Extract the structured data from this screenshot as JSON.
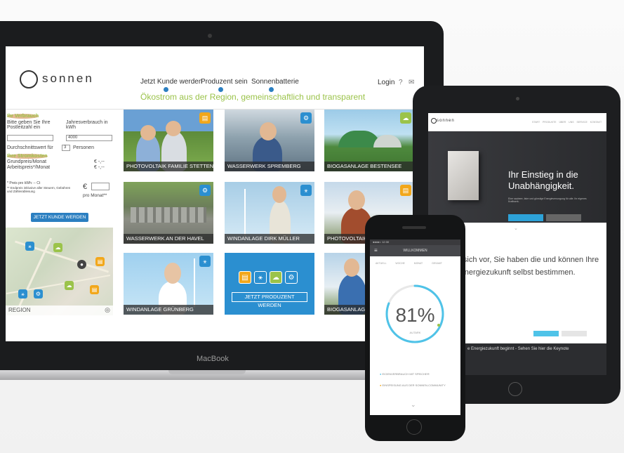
{
  "laptop": {
    "brand_label": "MacBook",
    "logo_text": "sonnen",
    "nav": {
      "item1": "Jetzt Kunde werden",
      "item2": "Produzent sein",
      "item3": "Sonnenbatterie"
    },
    "tagline": "Ökostrom aus der Region, gemeinschaftlich und transparent",
    "login": "Login",
    "calculator": {
      "heading_usage": "Ihr Verbrauch",
      "postcode_label": "Bitte geben Sie Ihre Postleitzahl ein",
      "annual_label": "Jahresverbrauch in kWh",
      "annual_value": "4000",
      "avg_label": "Durchschnittswert für",
      "persons_value": "3",
      "persons_label": "Personen",
      "heading_costs": "Ihre Stromkosten",
      "base_price_label": "Grundpreis/Monat",
      "base_price_value": "€ -,--",
      "work_price_label": "Arbeitspreis*/Monat",
      "work_price_value": "€ -,--",
      "note1": "* Preis pro kWh: -- Ct",
      "note2": "** Endpreis inklusive aller Steuern, Gebühren und Zählerablesung",
      "euro_sign": "€",
      "per_month": "pro Monat**",
      "cta": "JETZT KUNDE WERDEN"
    },
    "map": {
      "region_label": "REGION"
    },
    "tiles": [
      {
        "kind": "PHOTOVOLTAIK",
        "name": "FAMILIE STETTEN"
      },
      {
        "kind": "WASSERWERK",
        "name": "SPREMBERG"
      },
      {
        "kind": "BIOGASANLAGE",
        "name": "BESTENSEE"
      },
      {
        "kind": "WASSERWERK",
        "name": "AN DER HAVEL"
      },
      {
        "kind": "WINDANLAGE",
        "name": "DIRK MÜLLER"
      },
      {
        "kind": "PHOTOVOLTAIK",
        "name": "W"
      },
      {
        "kind": "WINDANLAGE",
        "name": "GRÜNBERG"
      },
      {
        "kind": "BIOGASANLAGE",
        "name": "C"
      }
    ],
    "produzent_cta": "JETZT PRODUZENT WERDEN"
  },
  "tablet": {
    "logo_text": "sonnen",
    "nav": "START  PRODUKTE  ÜBER UNS  SERVICE  KONTAKT",
    "hero_title": "Ihr Einstieg in die Unabhängigkeit.",
    "hero_sub": "Eine saubere, faire und günstige Energieversorgung für alle. Ihr eigenes Kraftwerk.",
    "body_text": "llen Sie sich vor, Sie haben die und können Ihre Energiezukunft selbst bestimmen.",
    "footer_title": "e Energiezukunft beginnt - Sehen Sie hier die Keynote"
  },
  "phone": {
    "status": "●●●●○ 12:30",
    "bar_title": "WILLKOMMEN",
    "tabs": "AKTUELL  WOCHE  MONAT  GESAMT",
    "percent": "81%",
    "percent_sub": "AUTARK",
    "item1": "EIGENVERBRAUCH MIT SPEICHER",
    "item2": "EINSPEISUNG AUS DER SONNEN-COMMUNITY"
  },
  "colors": {
    "accent_blue": "#2b7fc1",
    "accent_green": "#9bc34a",
    "icon_orange": "#f2a71b",
    "ring_teal": "#4fc3e8"
  }
}
